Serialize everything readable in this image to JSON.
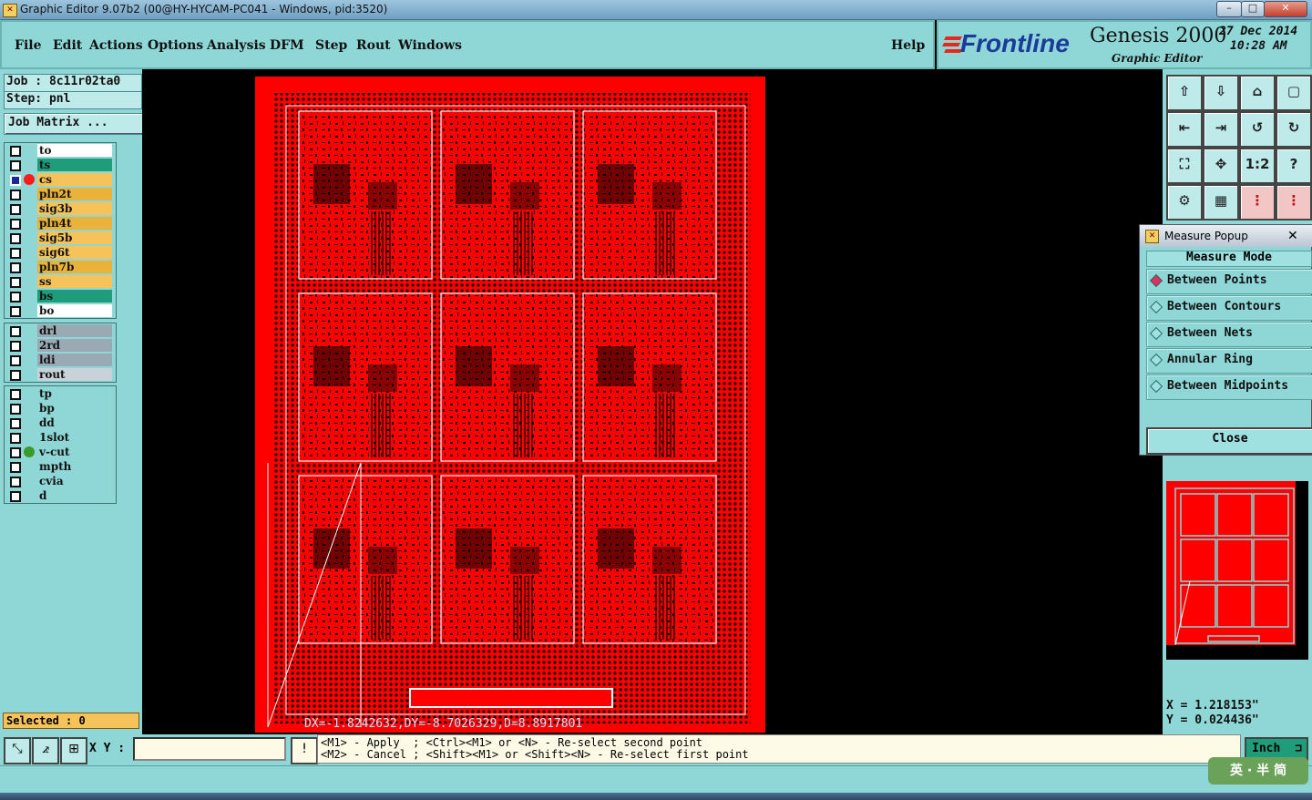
{
  "window": {
    "title": "Graphic Editor 9.07b2 (00@HY-HYCAM-PC041 - Windows, pid:3520)",
    "icon": "app-icon",
    "controls": [
      "–",
      "□",
      "✕"
    ]
  },
  "menu": {
    "items": [
      "File",
      "Edit",
      "Actions",
      "Options",
      "Analysis",
      "DFM",
      "Step",
      "Rout",
      "Windows"
    ],
    "help": "Help"
  },
  "branding": {
    "company": "Frontline",
    "product": "Genesis 2000",
    "subtitle": "Graphic Editor",
    "date": "27 Dec 2014",
    "time": "10:28 AM",
    "accent_color": "#e8281a"
  },
  "job": {
    "job_label": "Job : 8c11r02ta0",
    "step_label": "Step: pnl",
    "matrix_button": "Job Matrix ..."
  },
  "layers": {
    "group1": [
      {
        "name": "to",
        "color": "#ffffff"
      },
      {
        "name": "ts",
        "color": "#1f9d7b"
      },
      {
        "name": "cs",
        "color": "#f5c35a",
        "active": true
      },
      {
        "name": "pln2t",
        "color": "#e8b23b"
      },
      {
        "name": "sig3b",
        "color": "#f5c35a"
      },
      {
        "name": "pln4t",
        "color": "#e8b23b"
      },
      {
        "name": "sig5b",
        "color": "#f5c35a"
      },
      {
        "name": "sig6t",
        "color": "#f5c35a"
      },
      {
        "name": "pln7b",
        "color": "#e8b23b"
      },
      {
        "name": "ss",
        "color": "#f5c35a"
      },
      {
        "name": "bs",
        "color": "#1f9d7b"
      },
      {
        "name": "bo",
        "color": "#ffffff"
      }
    ],
    "group2": [
      {
        "name": "drl",
        "color": "#9aaab4"
      },
      {
        "name": "2rd",
        "color": "#9aaab4"
      },
      {
        "name": "ldi",
        "color": "#9aaab4"
      },
      {
        "name": "rout",
        "color": "#c9d2d8"
      }
    ],
    "group3": [
      {
        "name": "tp",
        "color": "#8fd7d7"
      },
      {
        "name": "bp",
        "color": "#8fd7d7"
      },
      {
        "name": "dd",
        "color": "#8fd7d7"
      },
      {
        "name": "1slot",
        "color": "#8fd7d7"
      },
      {
        "name": "v-cut",
        "color": "#8fd7d7",
        "marker": true
      },
      {
        "name": "mpth",
        "color": "#8fd7d7"
      },
      {
        "name": "cvia",
        "color": "#8fd7d7"
      },
      {
        "name": "d",
        "color": "#8fd7d7"
      }
    ]
  },
  "selected": "Selected : 0",
  "measure": {
    "title": "Measure Popup",
    "heading": "Measure Mode",
    "options": [
      "Between Points",
      "Between Contours",
      "Between Nets",
      "Annular Ring",
      "Between Midpoints"
    ],
    "close": "Close"
  },
  "coords": {
    "x": "X = 1.218153\"",
    "y": "Y = 0.024436\""
  },
  "canvas": {
    "measure_readout": "DX=-1.8242632,DY=-8.7026329,D=8.8917801",
    "board_color": "#ff0000",
    "unit_grid": {
      "rows": 3,
      "cols": 3
    }
  },
  "bottom": {
    "xy_label": "X Y :",
    "xy_value": "",
    "warn_icon": "!",
    "hint_line1": "<M1> - Apply  ; <Ctrl><M1> or <N> - Re-select second point",
    "hint_line2": "<M2> - Cancel ; <Shift><M1> or <Shift><N> - Re-select first point",
    "units": "Inch",
    "ime_text": "英 · 半 简"
  },
  "toolbar_icons": [
    "layer-up-icon",
    "layer-down-icon",
    "home-icon",
    "window-icon",
    "zoom-left-icon",
    "zoom-right-icon",
    "flip-icon",
    "mirror-icon",
    "fit-icon",
    "center-icon",
    "ratio-icon",
    "help-icon",
    "tools-icon",
    "grid-icon",
    "components-icon",
    "components-red-icon"
  ],
  "toolbar_glyphs": [
    "⇧",
    "⇩",
    "⌂",
    "▢",
    "⇤",
    "⇥",
    "↺",
    "↻",
    "⛶",
    "✥",
    "1:2",
    "?",
    "⚙",
    "▦",
    "⋮",
    "⋮"
  ]
}
